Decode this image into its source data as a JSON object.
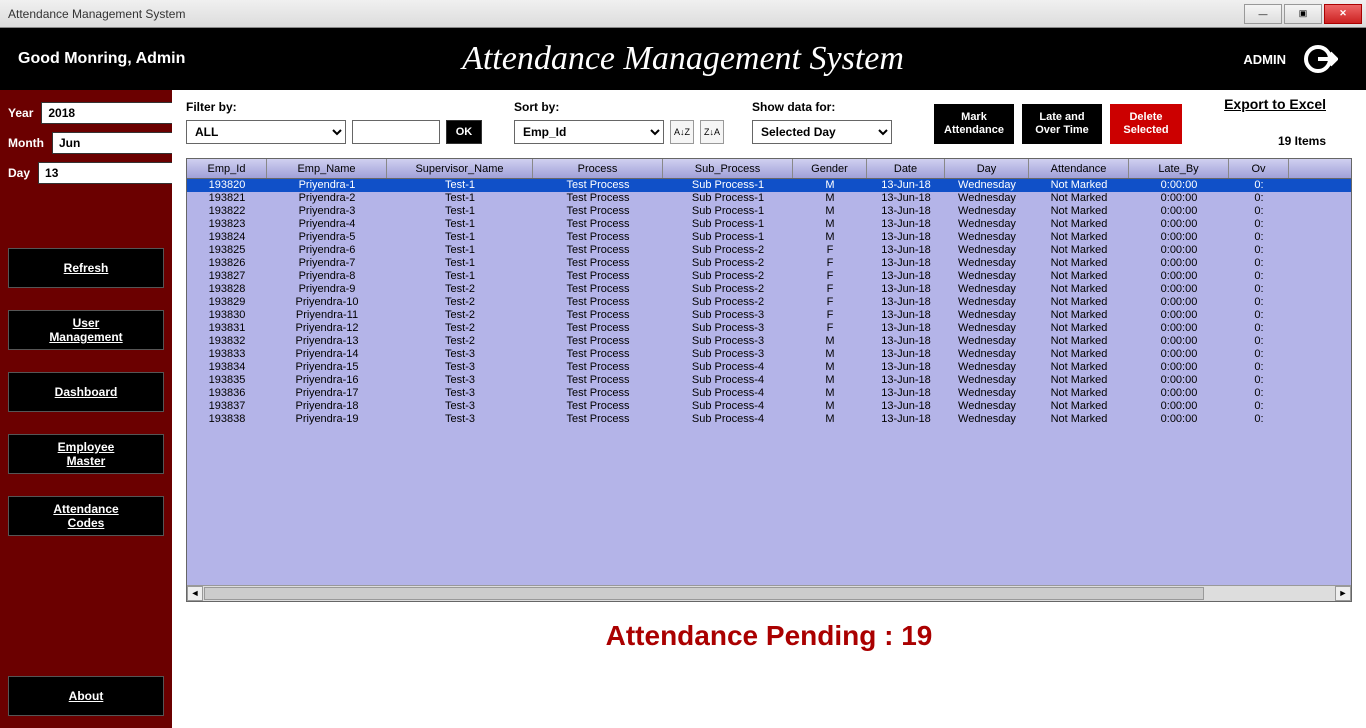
{
  "window": {
    "title": "Attendance Management System"
  },
  "header": {
    "greeting": "Good Monring, Admin",
    "app_title": "Attendance Management System",
    "admin_label": "ADMIN"
  },
  "sidebar": {
    "year_label": "Year",
    "year_value": "2018",
    "month_label": "Month",
    "month_value": "Jun",
    "day_label": "Day",
    "day_value": "13",
    "buttons": {
      "refresh": "Refresh",
      "user_mgmt": "User\nManagement",
      "dashboard": "Dashboard",
      "emp_master": "Employee\nMaster",
      "att_codes": "Attendance\nCodes",
      "about": "About"
    }
  },
  "toolbar": {
    "filter_label": "Filter by:",
    "filter_value": "ALL",
    "ok": "OK",
    "sort_label": "Sort by:",
    "sort_value": "Emp_Id",
    "show_label": "Show data for:",
    "show_value": "Selected Day",
    "mark": "Mark\nAttendance",
    "late": "Late and\nOver Time",
    "delete": "Delete\nSelected"
  },
  "export_link": "Export to Excel",
  "items_count": "19 Items",
  "columns": [
    "Emp_Id",
    "Emp_Name",
    "Supervisor_Name",
    "Process",
    "Sub_Process",
    "Gender",
    "Date",
    "Day",
    "Attendance",
    "Late_By",
    "Ov"
  ],
  "chart_data": {
    "type": "table",
    "columns": [
      "Emp_Id",
      "Emp_Name",
      "Supervisor_Name",
      "Process",
      "Sub_Process",
      "Gender",
      "Date",
      "Day",
      "Attendance",
      "Late_By",
      "Over"
    ],
    "rows": [
      [
        "193820",
        "Priyendra-1",
        "Test-1",
        "Test Process",
        "Sub Process-1",
        "M",
        "13-Jun-18",
        "Wednesday",
        "Not Marked",
        "0:00:00",
        "0:"
      ],
      [
        "193821",
        "Priyendra-2",
        "Test-1",
        "Test Process",
        "Sub Process-1",
        "M",
        "13-Jun-18",
        "Wednesday",
        "Not Marked",
        "0:00:00",
        "0:"
      ],
      [
        "193822",
        "Priyendra-3",
        "Test-1",
        "Test Process",
        "Sub Process-1",
        "M",
        "13-Jun-18",
        "Wednesday",
        "Not Marked",
        "0:00:00",
        "0:"
      ],
      [
        "193823",
        "Priyendra-4",
        "Test-1",
        "Test Process",
        "Sub Process-1",
        "M",
        "13-Jun-18",
        "Wednesday",
        "Not Marked",
        "0:00:00",
        "0:"
      ],
      [
        "193824",
        "Priyendra-5",
        "Test-1",
        "Test Process",
        "Sub Process-1",
        "M",
        "13-Jun-18",
        "Wednesday",
        "Not Marked",
        "0:00:00",
        "0:"
      ],
      [
        "193825",
        "Priyendra-6",
        "Test-1",
        "Test Process",
        "Sub Process-2",
        "F",
        "13-Jun-18",
        "Wednesday",
        "Not Marked",
        "0:00:00",
        "0:"
      ],
      [
        "193826",
        "Priyendra-7",
        "Test-1",
        "Test Process",
        "Sub Process-2",
        "F",
        "13-Jun-18",
        "Wednesday",
        "Not Marked",
        "0:00:00",
        "0:"
      ],
      [
        "193827",
        "Priyendra-8",
        "Test-1",
        "Test Process",
        "Sub Process-2",
        "F",
        "13-Jun-18",
        "Wednesday",
        "Not Marked",
        "0:00:00",
        "0:"
      ],
      [
        "193828",
        "Priyendra-9",
        "Test-2",
        "Test Process",
        "Sub Process-2",
        "F",
        "13-Jun-18",
        "Wednesday",
        "Not Marked",
        "0:00:00",
        "0:"
      ],
      [
        "193829",
        "Priyendra-10",
        "Test-2",
        "Test Process",
        "Sub Process-2",
        "F",
        "13-Jun-18",
        "Wednesday",
        "Not Marked",
        "0:00:00",
        "0:"
      ],
      [
        "193830",
        "Priyendra-11",
        "Test-2",
        "Test Process",
        "Sub Process-3",
        "F",
        "13-Jun-18",
        "Wednesday",
        "Not Marked",
        "0:00:00",
        "0:"
      ],
      [
        "193831",
        "Priyendra-12",
        "Test-2",
        "Test Process",
        "Sub Process-3",
        "F",
        "13-Jun-18",
        "Wednesday",
        "Not Marked",
        "0:00:00",
        "0:"
      ],
      [
        "193832",
        "Priyendra-13",
        "Test-2",
        "Test Process",
        "Sub Process-3",
        "M",
        "13-Jun-18",
        "Wednesday",
        "Not Marked",
        "0:00:00",
        "0:"
      ],
      [
        "193833",
        "Priyendra-14",
        "Test-3",
        "Test Process",
        "Sub Process-3",
        "M",
        "13-Jun-18",
        "Wednesday",
        "Not Marked",
        "0:00:00",
        "0:"
      ],
      [
        "193834",
        "Priyendra-15",
        "Test-3",
        "Test Process",
        "Sub Process-4",
        "M",
        "13-Jun-18",
        "Wednesday",
        "Not Marked",
        "0:00:00",
        "0:"
      ],
      [
        "193835",
        "Priyendra-16",
        "Test-3",
        "Test Process",
        "Sub Process-4",
        "M",
        "13-Jun-18",
        "Wednesday",
        "Not Marked",
        "0:00:00",
        "0:"
      ],
      [
        "193836",
        "Priyendra-17",
        "Test-3",
        "Test Process",
        "Sub Process-4",
        "M",
        "13-Jun-18",
        "Wednesday",
        "Not Marked",
        "0:00:00",
        "0:"
      ],
      [
        "193837",
        "Priyendra-18",
        "Test-3",
        "Test Process",
        "Sub Process-4",
        "M",
        "13-Jun-18",
        "Wednesday",
        "Not Marked",
        "0:00:00",
        "0:"
      ],
      [
        "193838",
        "Priyendra-19",
        "Test-3",
        "Test Process",
        "Sub Process-4",
        "M",
        "13-Jun-18",
        "Wednesday",
        "Not Marked",
        "0:00:00",
        "0:"
      ]
    ]
  },
  "status": "Attendance Pending : 19"
}
